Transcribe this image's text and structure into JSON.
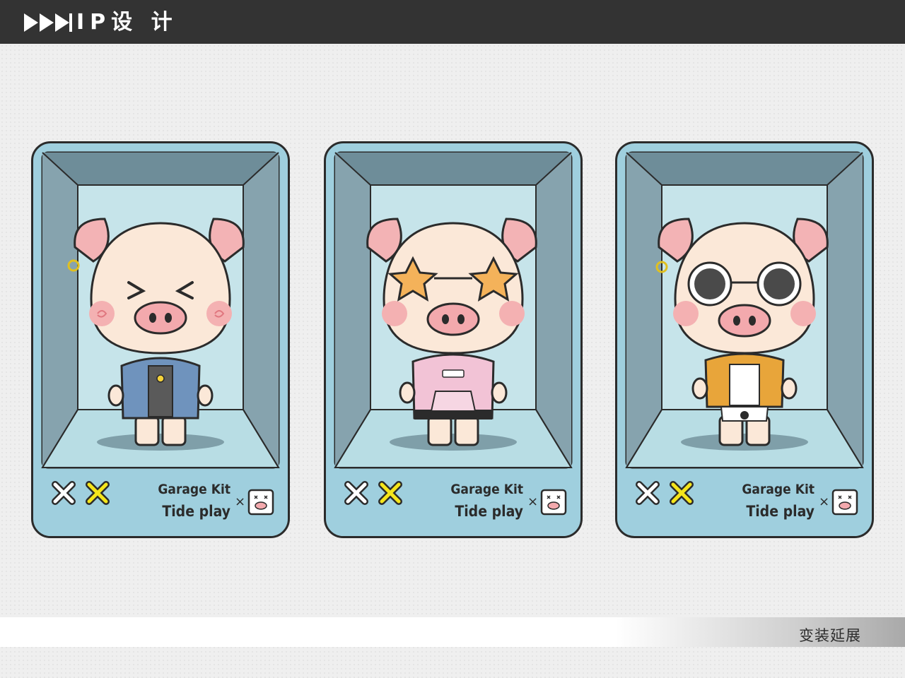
{
  "header": {
    "title": "IP设 计",
    "icon": "play-arrows-icon",
    "bg_color": "#333333"
  },
  "cards": [
    {
      "outfit": "denim-jacket",
      "text_line1": "Garage Kit",
      "text_line2": "Tide play",
      "times": "×"
    },
    {
      "outfit": "pink-hoodie-star-glasses",
      "text_line1": "Garage Kit",
      "text_line2": "Tide play",
      "times": "×"
    },
    {
      "outfit": "hawaiian-shirt-sunglasses",
      "text_line1": "Garage Kit",
      "text_line2": "Tide play",
      "times": "×"
    }
  ],
  "footer": {
    "label": "变装延展"
  },
  "colors": {
    "card_bg": "#9fcfde",
    "frame": "#7b98a4",
    "inner": "#c6e4ea",
    "pig_skin": "#fbe8d8",
    "pig_pink": "#f3b3b5",
    "accent_yellow": "#f5e51a"
  }
}
